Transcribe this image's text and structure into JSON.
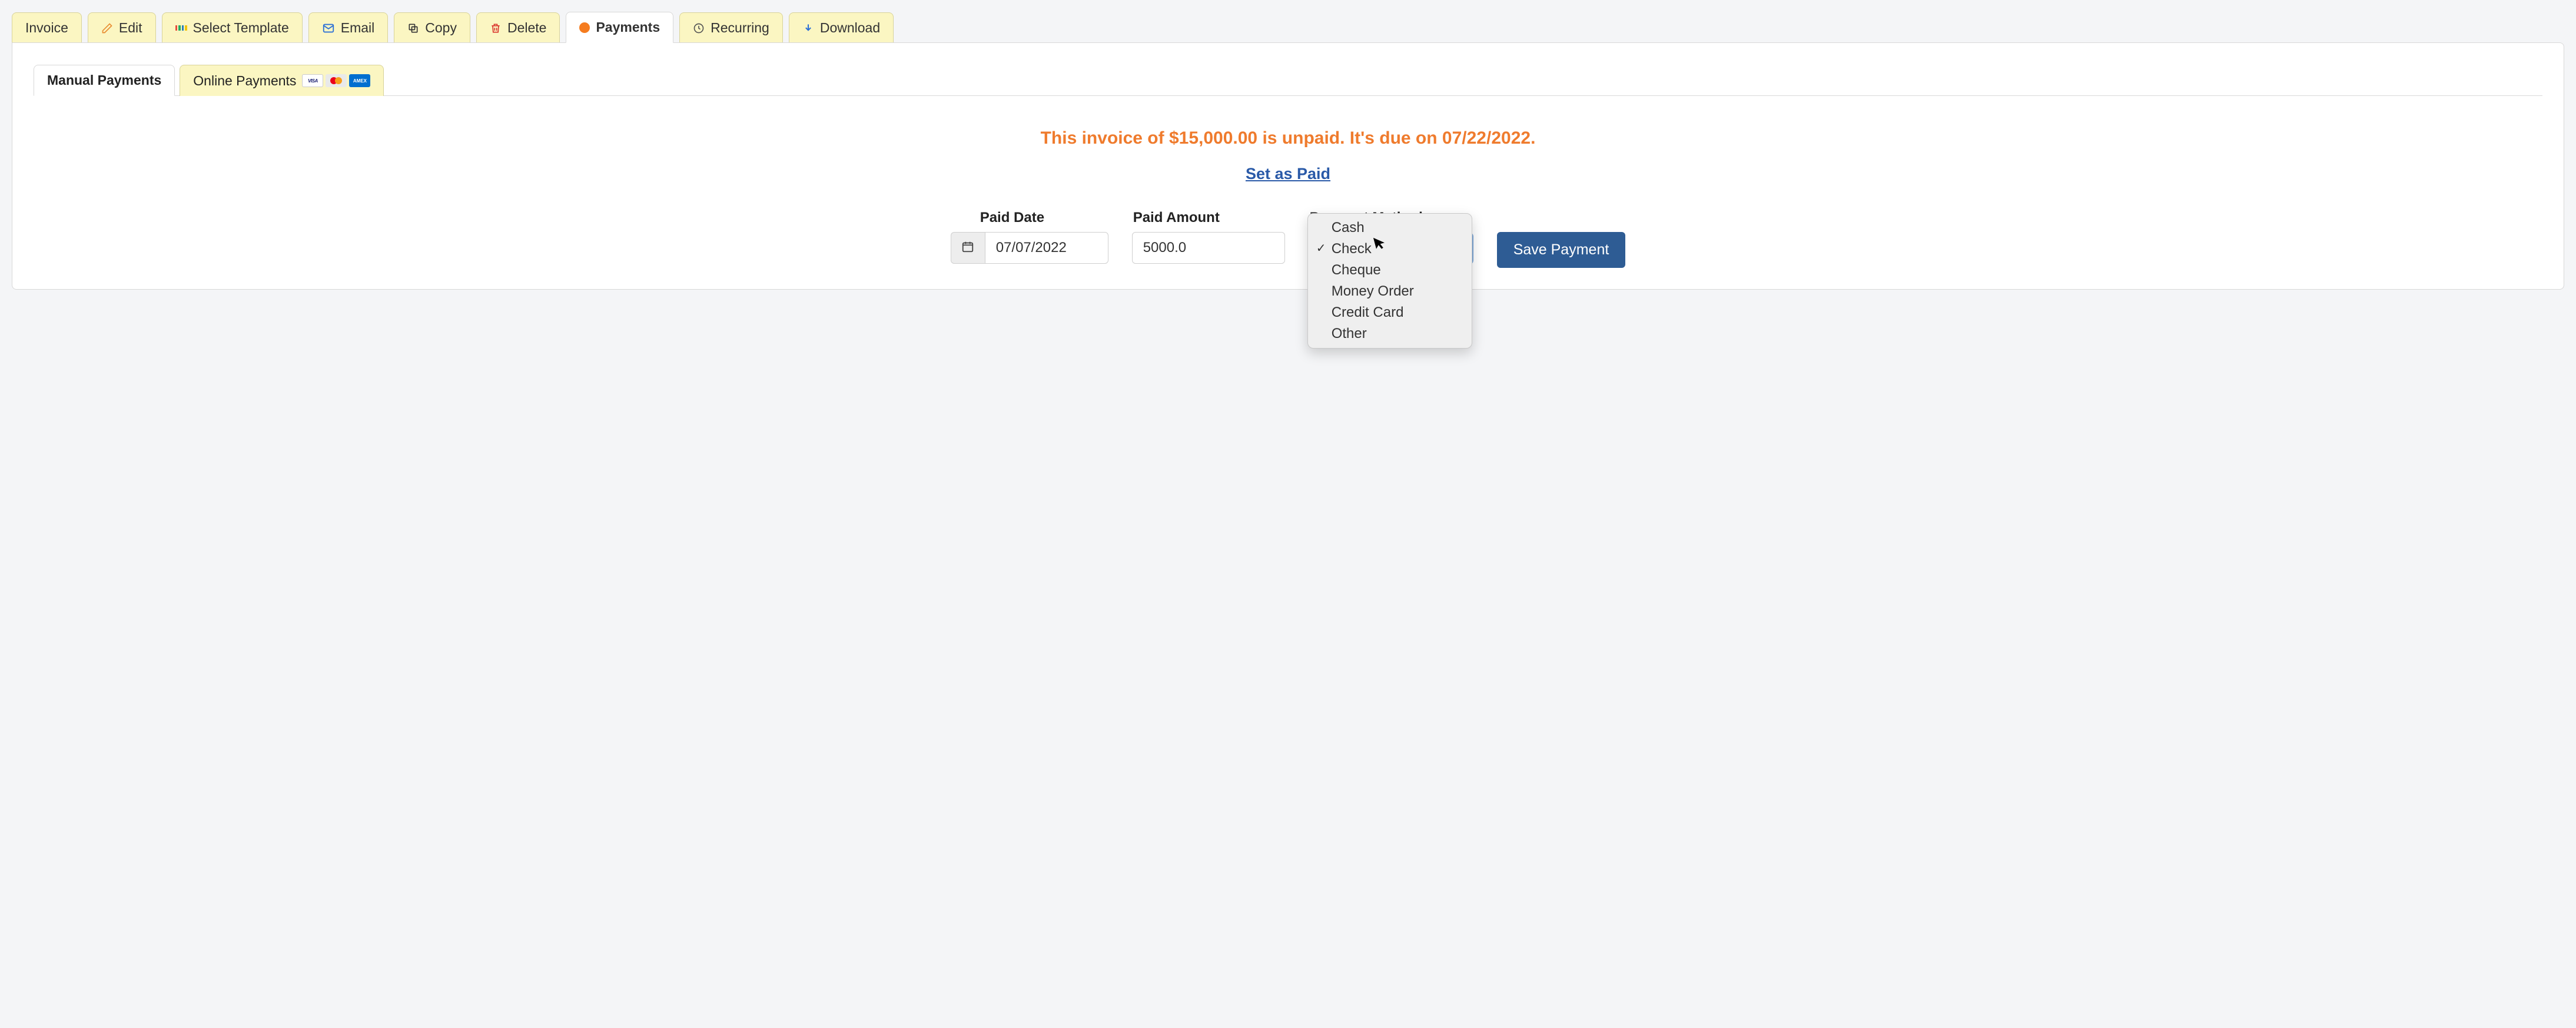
{
  "tabs": {
    "invoice": "Invoice",
    "edit": "Edit",
    "select_template": "Select Template",
    "email": "Email",
    "copy": "Copy",
    "delete": "Delete",
    "payments": "Payments",
    "recurring": "Recurring",
    "download": "Download"
  },
  "sub_tabs": {
    "manual": "Manual Payments",
    "online": "Online Payments"
  },
  "status_message": "This invoice of $15,000.00 is unpaid. It's due on 07/22/2022.",
  "set_paid_label": "Set as Paid",
  "form": {
    "paid_date_label": "Paid Date",
    "paid_date_value": "07/07/2022",
    "paid_amount_label": "Paid Amount",
    "paid_amount_value": "5000.0",
    "payment_method_label": "Payment Method",
    "payment_method_value": "Check",
    "save_label": "Save Payment"
  },
  "payment_methods": {
    "cash": "Cash",
    "check": "Check",
    "cheque": "Cheque",
    "money_order": "Money Order",
    "credit_card": "Credit Card",
    "other": "Other"
  },
  "card_brands": {
    "visa": "VISA",
    "amex": "AMEX"
  }
}
